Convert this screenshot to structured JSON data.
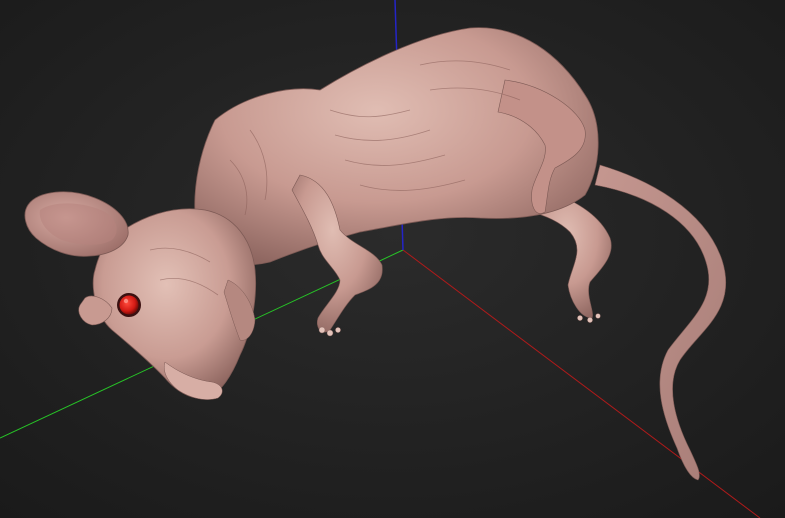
{
  "viewport": {
    "background": "#1f1f1f",
    "background_center": "#2b2b2b"
  },
  "axes": {
    "x_color": "#b01a1a",
    "y_color": "#27c427",
    "z_color": "#2424c8"
  },
  "model": {
    "name": "hairless-mouse-model",
    "skin_color": "#c89a91",
    "skin_shadow": "#8e6660",
    "skin_highlight": "#e2c0b6",
    "eye_color": "#d21a14"
  }
}
